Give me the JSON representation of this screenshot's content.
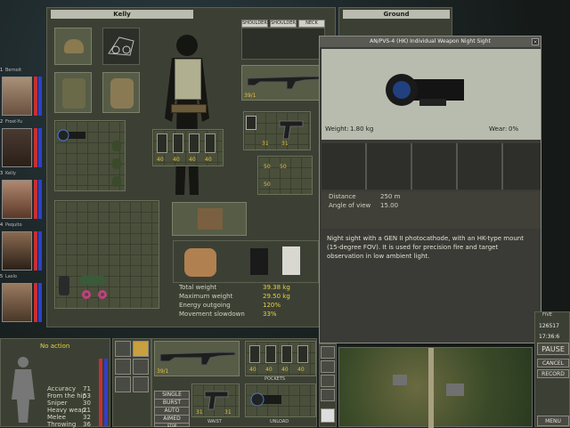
{
  "inventory": {
    "title": "Kelly"
  },
  "ground": {
    "title": "Ground"
  },
  "tabs": [
    {
      "label": "SHOULDERS"
    },
    {
      "label": "SHOULDER"
    },
    {
      "label": "NECK"
    }
  ],
  "weapon_slot": {
    "ammo": "39/1"
  },
  "pistol_slot": {
    "ammo_left": "31",
    "ammo_right": "31"
  },
  "mags": {
    "values": [
      "40",
      "40",
      "40",
      "40"
    ]
  },
  "small_mags": {
    "values": [
      "50",
      "50",
      "50"
    ]
  },
  "stats": {
    "rows": [
      {
        "label": "Total weight",
        "value": "39.38 kg"
      },
      {
        "label": "Maximum weight",
        "value": "29.50 kg"
      },
      {
        "label": "Energy outgoing",
        "value": "120%"
      },
      {
        "label": "Movement slowdown",
        "value": "33%"
      }
    ]
  },
  "squad": [
    {
      "name": "Bernoit",
      "number": "1"
    },
    {
      "name": "Frost-Yu",
      "number": "2"
    },
    {
      "name": "Kelly",
      "number": "3"
    },
    {
      "name": "Pequito",
      "number": "4"
    },
    {
      "name": "Laslo",
      "number": "5"
    }
  ],
  "item_popup": {
    "title": "AN/PVS-4 (HK) Individual Weapon Night Sight",
    "weight_label": "Weight:",
    "weight_value": "1.80 kg",
    "wear_label": "Wear:",
    "wear_value": "0%",
    "distance_label": "Distance",
    "distance_value": "250 m",
    "angle_label": "Angle of view",
    "angle_value": "15.00",
    "description": "Night sight with a GEN II photocathode, with an HK-type mount (15-degree FOV). It is used for precision fire and target observation in low ambient light."
  },
  "selected_soldier": {
    "action": "No action",
    "skills": [
      {
        "label": "Accuracy",
        "value": "71"
      },
      {
        "label": "From the hip",
        "value": "53"
      },
      {
        "label": "Sniper",
        "value": "30"
      },
      {
        "label": "Heavy weap.",
        "value": "21"
      },
      {
        "label": "Melee",
        "value": "32"
      },
      {
        "label": "Throwing",
        "value": "36"
      }
    ]
  },
  "quick_bar": {
    "weapon_ammo": "39/1",
    "pockets_label": "POCKETS",
    "waist_label": "WAIST",
    "unload_label": "UNLOAD",
    "pistol_ammo_left": "31",
    "pistol_ammo_right": "31",
    "fire_modes": [
      "SINGLE",
      "BURST",
      "AUTO",
      "AIMED",
      "STOP"
    ],
    "pocket_mags": [
      "40",
      "40",
      "40",
      "40"
    ]
  },
  "right_panel": {
    "time_top": "FIVE",
    "counter": "126517",
    "clock": "17:36:6",
    "pause": "PAUSE",
    "cancel": "CANCEL",
    "record": "RECORD",
    "menu": "MENU"
  },
  "colors": {
    "accent_yellow": "#e8d040",
    "panel_bg": "#3c4034",
    "header_bg": "#b9bcae",
    "hp_red": "#c83030",
    "hp_blue": "#3040c8"
  }
}
